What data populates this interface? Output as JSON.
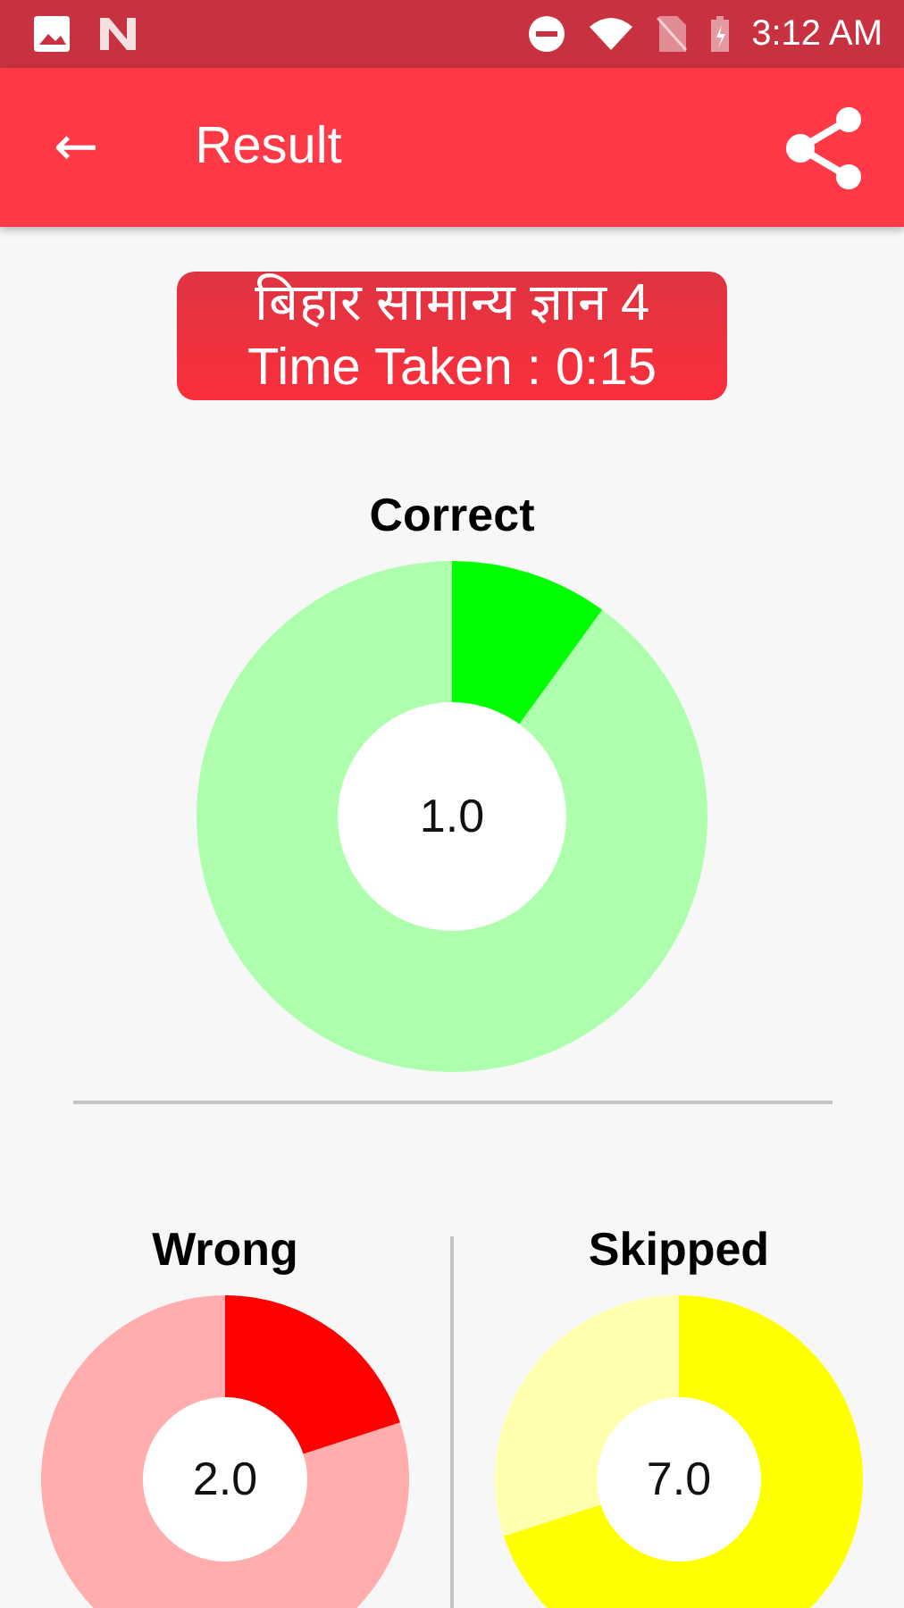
{
  "status_bar": {
    "time": "3:12 AM"
  },
  "app_bar": {
    "back": "←",
    "title": "Result"
  },
  "result_card": {
    "quiz_title": "बिहार सामान्य ज्ञान 4",
    "time_taken": "Time Taken : 0:15"
  },
  "charts": [
    {
      "title": "Correct",
      "value": "1.0",
      "color": "#00ff00"
    },
    {
      "title": "Wrong",
      "value": "2.0",
      "color": "#ff0000"
    },
    {
      "title": "Skipped",
      "value": "7.0",
      "color": "#ffff00"
    }
  ]
}
